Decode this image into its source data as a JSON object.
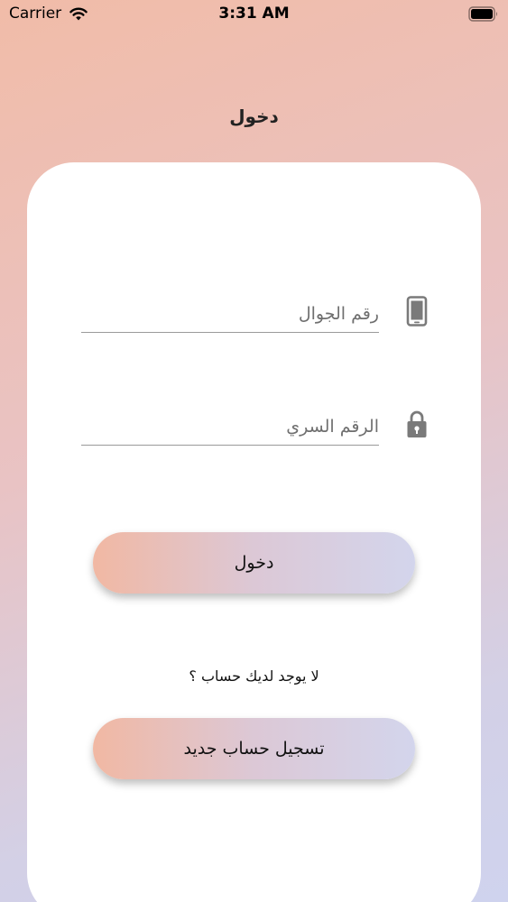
{
  "status_bar": {
    "carrier": "Carrier",
    "time": "3:31 AM"
  },
  "header": {
    "title": "دخول"
  },
  "form": {
    "phone_placeholder": "رقم الجوال",
    "password_placeholder": "الرقم السري",
    "phone_icon": "smartphone-icon",
    "password_icon": "lock-icon"
  },
  "actions": {
    "login_label": "دخول",
    "no_account_text": "لا يوجد لديك حساب ؟",
    "register_label": "تسجيل حساب جديد"
  },
  "colors": {
    "gradient_start": "#f1b8a3",
    "gradient_end": "#d3d5ec",
    "card": "#ffffff",
    "icon_gray": "#7a7a7a"
  }
}
